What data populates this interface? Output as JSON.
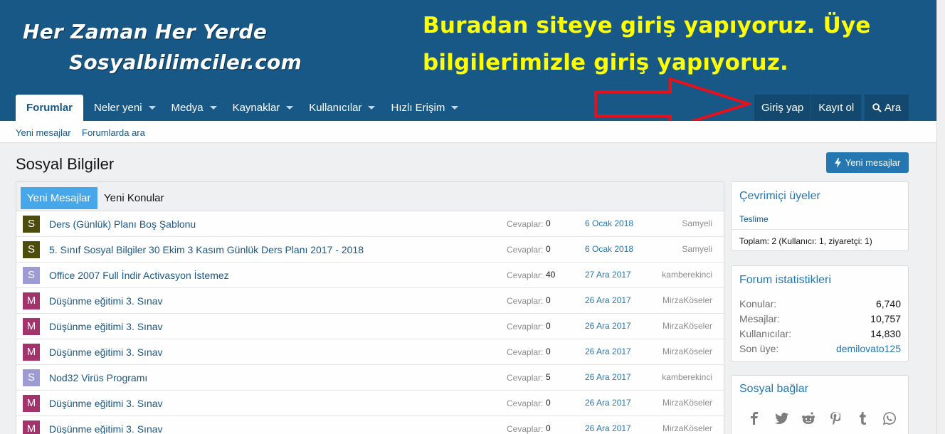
{
  "logo": {
    "line1": "Her Zaman Her Yerde",
    "line2": "Sosyalbilimciler.com"
  },
  "annotation": {
    "line1": "Buradan siteye giriş yapıyoruz. Üye",
    "line2": "bilgilerimizle giriş yapıyoruz."
  },
  "nav": {
    "tabs": [
      {
        "label": "Forumlar",
        "active": true
      },
      {
        "label": "Neler yeni"
      },
      {
        "label": "Medya"
      },
      {
        "label": "Kaynaklar"
      },
      {
        "label": "Kullanıcılar"
      },
      {
        "label": "Hızlı Erişim"
      }
    ],
    "login": "Giriş yap",
    "register": "Kayıt ol",
    "search": "Ara"
  },
  "subnav": {
    "new_posts": "Yeni mesajlar",
    "search_forums": "Forumlarda ara"
  },
  "page": {
    "title": "Sosyal Bilgiler",
    "new_posts_button": "Yeni mesajlar"
  },
  "main": {
    "tabs": [
      "Yeni Mesajlar",
      "Yeni Konular"
    ],
    "reply_label": "Cevaplar:",
    "threads": [
      {
        "avatar": "S",
        "color": "#4c4c0d",
        "title": "Ders (Günlük) Planı Boş Şablonu",
        "replies": "0",
        "date": "6 Ocak 2018",
        "user": "Samyeli"
      },
      {
        "avatar": "S",
        "color": "#4c4c0d",
        "title": "5. Sınıf Sosyal Bilgiler 30 Ekim 3 Kasım Günlük Ders Planı 2017 - 2018",
        "replies": "0",
        "date": "6 Ocak 2018",
        "user": "Samyeli"
      },
      {
        "avatar": "S",
        "color": "#9e9ad3",
        "title": "Office 2007 Full İndir Activasyon İstemez",
        "replies": "40",
        "date": "27 Ara 2017",
        "user": "kamberekinci"
      },
      {
        "avatar": "M",
        "color": "#a3336b",
        "title": "Düşünme eğitimi 3. Sınav",
        "replies": "0",
        "date": "26 Ara 2017",
        "user": "MirzaKöseler"
      },
      {
        "avatar": "M",
        "color": "#a3336b",
        "title": "Düşünme eğitimi 3. Sınav",
        "replies": "0",
        "date": "26 Ara 2017",
        "user": "MirzaKöseler"
      },
      {
        "avatar": "M",
        "color": "#a3336b",
        "title": "Düşünme eğitimi 3. Sınav",
        "replies": "0",
        "date": "26 Ara 2017",
        "user": "MirzaKöseler"
      },
      {
        "avatar": "S",
        "color": "#9e9ad3",
        "title": "Nod32 Virüs Programı",
        "replies": "5",
        "date": "26 Ara 2017",
        "user": "kamberekinci"
      },
      {
        "avatar": "M",
        "color": "#a3336b",
        "title": "Düşünme eğitimi 3. Sınav",
        "replies": "0",
        "date": "26 Ara 2017",
        "user": "MirzaKöseler"
      },
      {
        "avatar": "M",
        "color": "#a3336b",
        "title": "Düşünme eğitimi 3. Sınav",
        "replies": "0",
        "date": "26 Ara 2017",
        "user": "MirzaKöseler"
      }
    ]
  },
  "sidebar": {
    "online": {
      "title": "Çevrimiçi üyeler",
      "member": "Teslime",
      "total": "Toplam: 2 (Kullanıcı: 1, ziyaretçi: 1)"
    },
    "stats": {
      "title": "Forum istatistikleri",
      "rows": [
        {
          "label": "Konular:",
          "value": "6,740"
        },
        {
          "label": "Mesajlar:",
          "value": "10,757"
        },
        {
          "label": "Kullanıcılar:",
          "value": "14,830"
        },
        {
          "label": "Son üye:",
          "value": "demilovato125"
        }
      ]
    },
    "social": {
      "title": "Sosyal bağlar",
      "icons": [
        "facebook-icon",
        "twitter-icon",
        "reddit-icon",
        "pinterest-icon",
        "tumblr-icon",
        "whatsapp-icon"
      ]
    }
  },
  "colors": {
    "header": "#185886",
    "accent": "#2577b1",
    "annotation": "#ffff00",
    "arrow": "#e8101a"
  }
}
